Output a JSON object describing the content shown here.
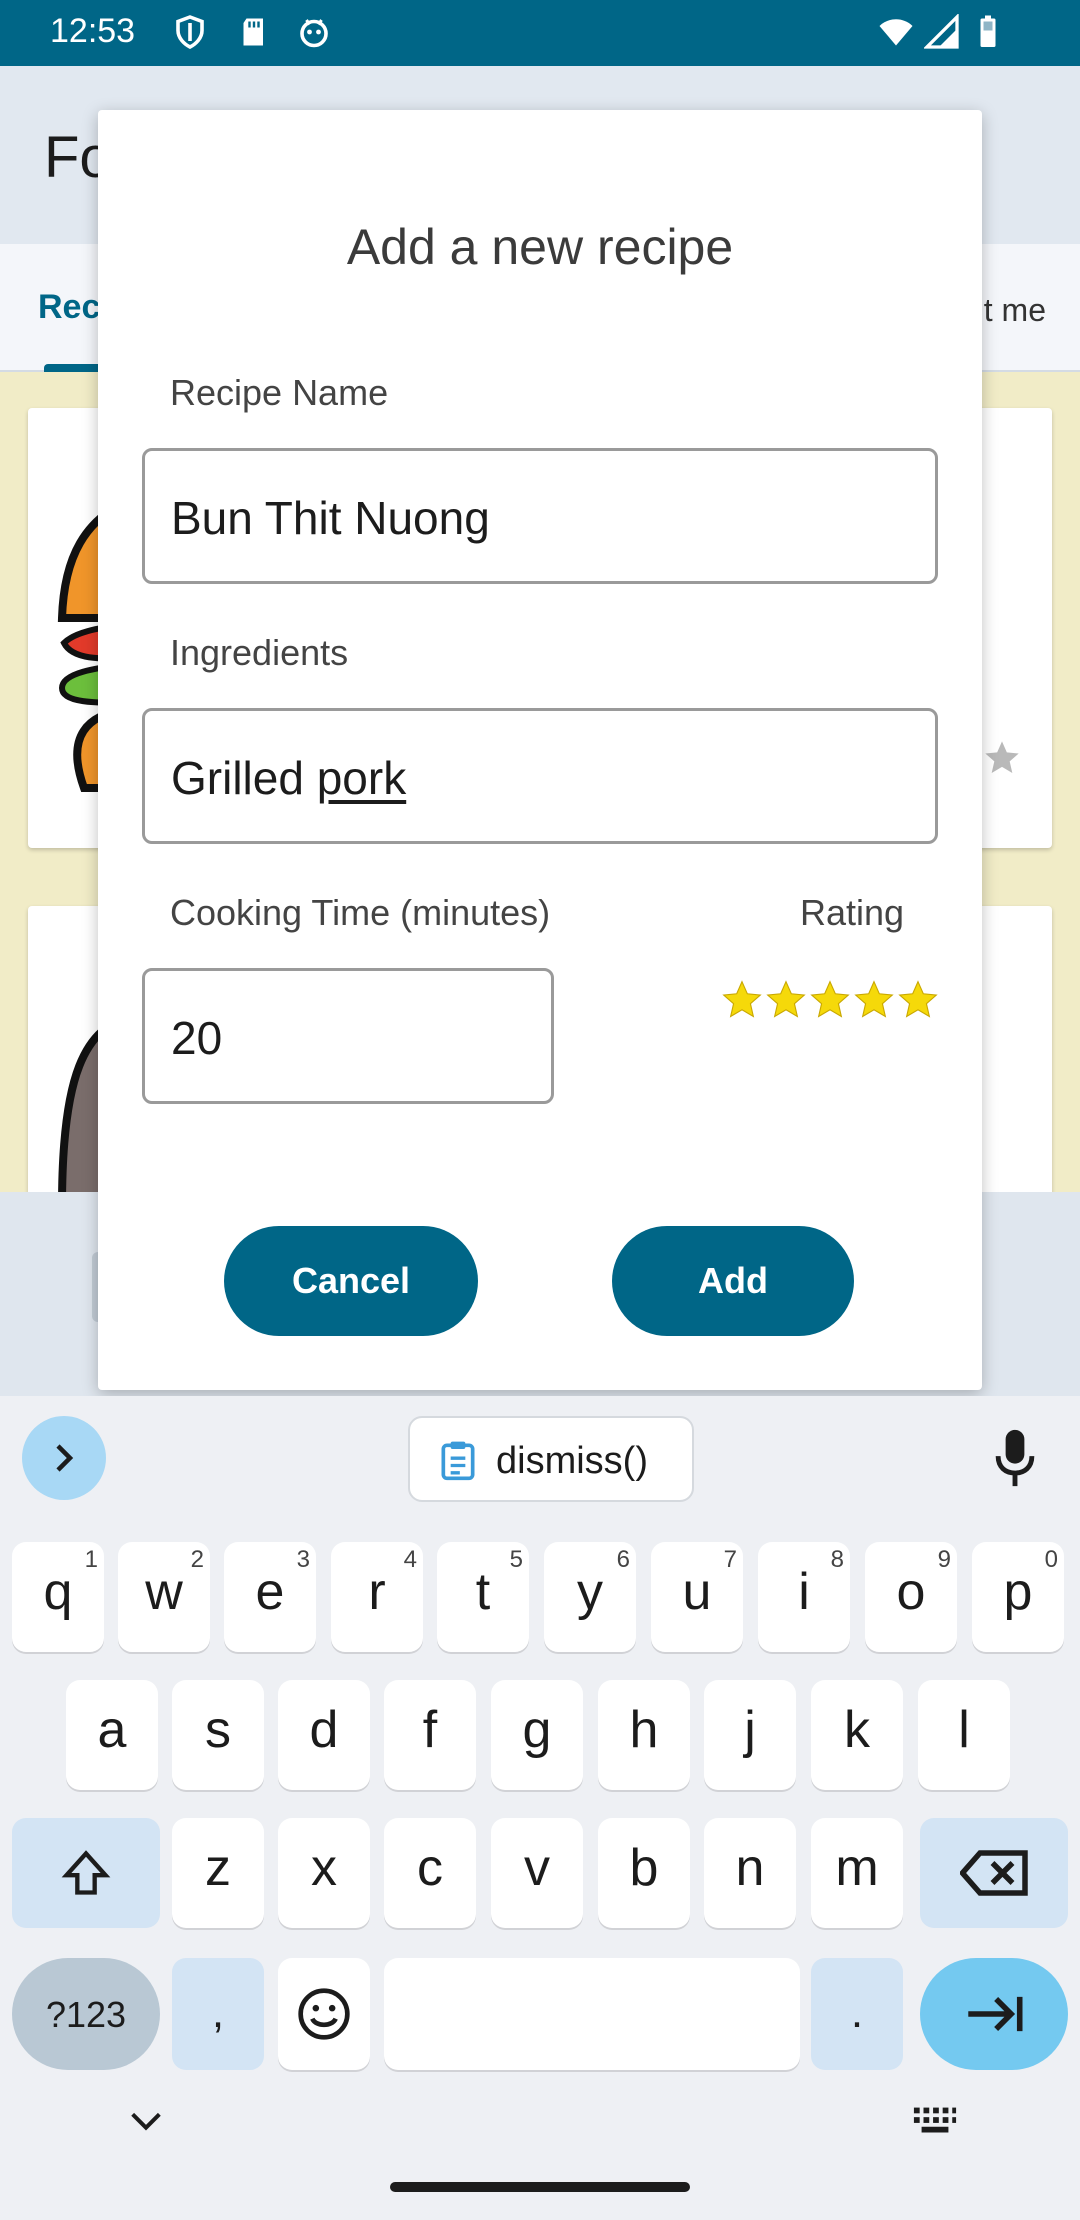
{
  "status_bar": {
    "time": "12:53",
    "icons": [
      "shield-icon",
      "sd-card-icon",
      "debug-icon",
      "wifi-icon",
      "signal-icon",
      "battery-icon"
    ]
  },
  "background_app": {
    "title_visible": "Fo",
    "tabs": [
      {
        "label": "Rec"
      },
      {
        "label": "t me"
      }
    ]
  },
  "dialog": {
    "title": "Add a new recipe",
    "recipe_name": {
      "label": "Recipe Name",
      "value": "Bun Thit Nuong"
    },
    "ingredients": {
      "label": "Ingredients",
      "value_start": "Grilled ",
      "value_composing": "pork"
    },
    "cooking_time": {
      "label": "Cooking Time (minutes)",
      "value": "20"
    },
    "rating": {
      "label": "Rating",
      "stars": 5,
      "max_stars": 5,
      "star_color": "#f5d90a"
    },
    "cancel_label": "Cancel",
    "add_label": "Add",
    "button_color": "#006687"
  },
  "keyboard": {
    "clipboard_suggestion": "dismiss()",
    "row1": [
      {
        "letter": "q",
        "num": "1"
      },
      {
        "letter": "w",
        "num": "2"
      },
      {
        "letter": "e",
        "num": "3"
      },
      {
        "letter": "r",
        "num": "4"
      },
      {
        "letter": "t",
        "num": "5"
      },
      {
        "letter": "y",
        "num": "6"
      },
      {
        "letter": "u",
        "num": "7"
      },
      {
        "letter": "i",
        "num": "8"
      },
      {
        "letter": "o",
        "num": "9"
      },
      {
        "letter": "p",
        "num": "0"
      }
    ],
    "row2": [
      "a",
      "s",
      "d",
      "f",
      "g",
      "h",
      "j",
      "k",
      "l"
    ],
    "row3": [
      "z",
      "x",
      "c",
      "v",
      "b",
      "n",
      "m"
    ],
    "symbols_label": "?123",
    "comma_label": ",",
    "period_label": "."
  }
}
